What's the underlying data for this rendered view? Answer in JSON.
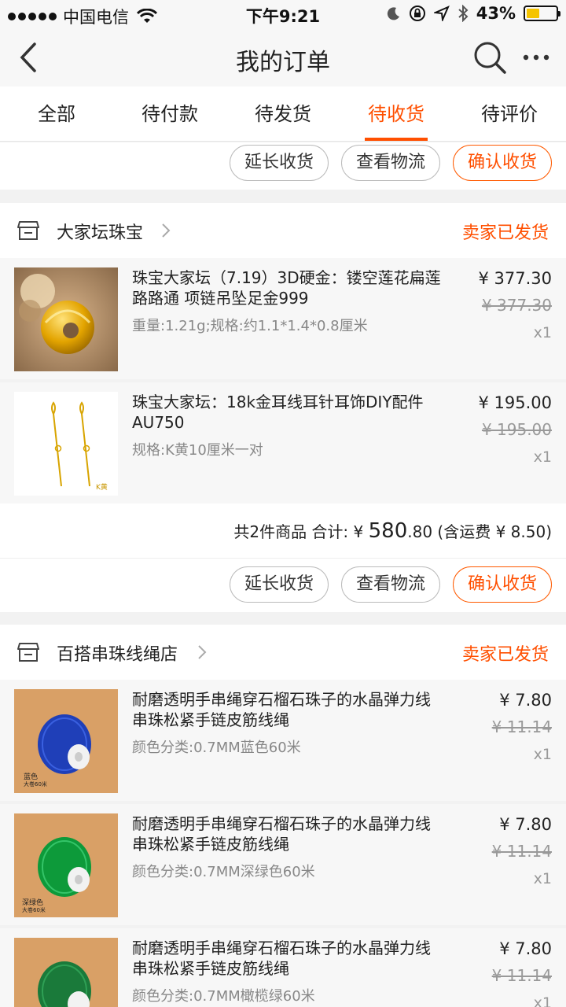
{
  "status_bar": {
    "carrier": "中国电信",
    "time": "下午9:21",
    "battery": "43%"
  },
  "nav": {
    "title": "我的订单",
    "back_icon": "chevron-left-icon",
    "search_icon": "search-icon",
    "more_icon": "more-icon"
  },
  "tabs": [
    {
      "label": "全部"
    },
    {
      "label": "待付款"
    },
    {
      "label": "待发货"
    },
    {
      "label": "待收货",
      "active": true
    },
    {
      "label": "待评价"
    }
  ],
  "actions": {
    "extend": "延长收货",
    "logistics": "查看物流",
    "confirm": "确认收货"
  },
  "orders": [
    {
      "shop": "大家坛珠宝",
      "status": "卖家已发货",
      "items": [
        {
          "title": "珠宝大家坛（7.19）3D硬金：镂空莲花扁莲路路通 项链吊坠足金999",
          "spec": "重量:1.21g;规格:约1.1*1.4*0.8厘米",
          "price": "¥ 377.30",
          "orig_price": "¥ 377.30",
          "qty": "x1"
        },
        {
          "title": "珠宝大家坛：18k金耳线耳针耳饰DIY配件 AU750",
          "spec": "规格:K黄10厘米一对",
          "price": "¥ 195.00",
          "orig_price": "¥ 195.00",
          "qty": "x1"
        }
      ],
      "summary_prefix": "共2件商品 合计: ¥ ",
      "summary_int": "580",
      "summary_dec": ".80",
      "summary_suffix": " (含运费 ¥ 8.50)"
    },
    {
      "shop": "百搭串珠线绳店",
      "status": "卖家已发货",
      "items": [
        {
          "title": "耐磨透明手串绳穿石榴石珠子的水晶弹力线 串珠松紧手链皮筋线绳",
          "spec": "颜色分类:0.7MM蓝色60米",
          "price": "¥ 7.80",
          "orig_price": "¥ 11.14",
          "qty": "x1",
          "thumb_label": "蓝色",
          "thumb_sub": "大卷60米"
        },
        {
          "title": "耐磨透明手串绳穿石榴石珠子的水晶弹力线 串珠松紧手链皮筋线绳",
          "spec": "颜色分类:0.7MM深绿色60米",
          "price": "¥ 7.80",
          "orig_price": "¥ 11.14",
          "qty": "x1",
          "thumb_label": "深绿色",
          "thumb_sub": "大卷60米"
        },
        {
          "title": "耐磨透明手串绳穿石榴石珠子的水晶弹力线 串珠松紧手链皮筋线绳",
          "spec": "颜色分类:0.7MM橄榄绿60米",
          "price": "¥ 7.80",
          "orig_price": "¥ 11.14",
          "qty": "x1"
        }
      ]
    }
  ],
  "earring_tag": "K黄",
  "colors": {
    "accent": "#ff4f00",
    "battery": "#f5c400"
  }
}
